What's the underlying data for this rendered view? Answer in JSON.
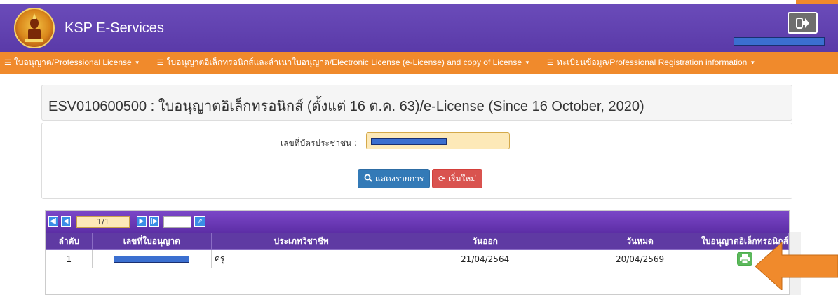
{
  "header": {
    "brand": "KSP E-Services",
    "logout_icon": "sign-out-icon",
    "logo_icon": "ksp-emblem-icon"
  },
  "nav": {
    "items": [
      {
        "label": "ใบอนุญาต/Professional License",
        "icon": "list-icon"
      },
      {
        "label": "ใบอนุญาตอิเล็กทรอนิกส์และสำเนาใบอนุญาต/Electronic License (e-License) and copy of License",
        "icon": "list-icon"
      },
      {
        "label": "ทะเบียนข้อมูล/Professional Registration information",
        "icon": "list-icon"
      }
    ]
  },
  "page": {
    "title": "ESV010600500 : ใบอนุญาตอิเล็กทรอนิกส์ (ตั้งแต่ 16 ต.ค. 63)/e-License (Since 16 October, 2020)"
  },
  "search": {
    "id_label": "เลขที่บัตรประชาชน :",
    "show_button": "แสดงรายการ",
    "reset_button": "เริ่มใหม่"
  },
  "grid": {
    "pager": {
      "page": "1/1"
    },
    "columns": [
      "ลำดับ",
      "เลขที่ใบอนุญาต",
      "ประเภทวิชาชีพ",
      "วันออก",
      "วันหมด",
      "ใบอนุญาตอิเล็กทรอนิกส์"
    ],
    "rows": [
      {
        "no": "1",
        "profession": "ครู",
        "issued": "21/04/2564",
        "expires": "20/04/2569"
      }
    ]
  },
  "colors": {
    "header_purple": "#5a3aa8",
    "nav_orange": "#f08a2c",
    "annotation_arrow": "#f08a2c"
  }
}
